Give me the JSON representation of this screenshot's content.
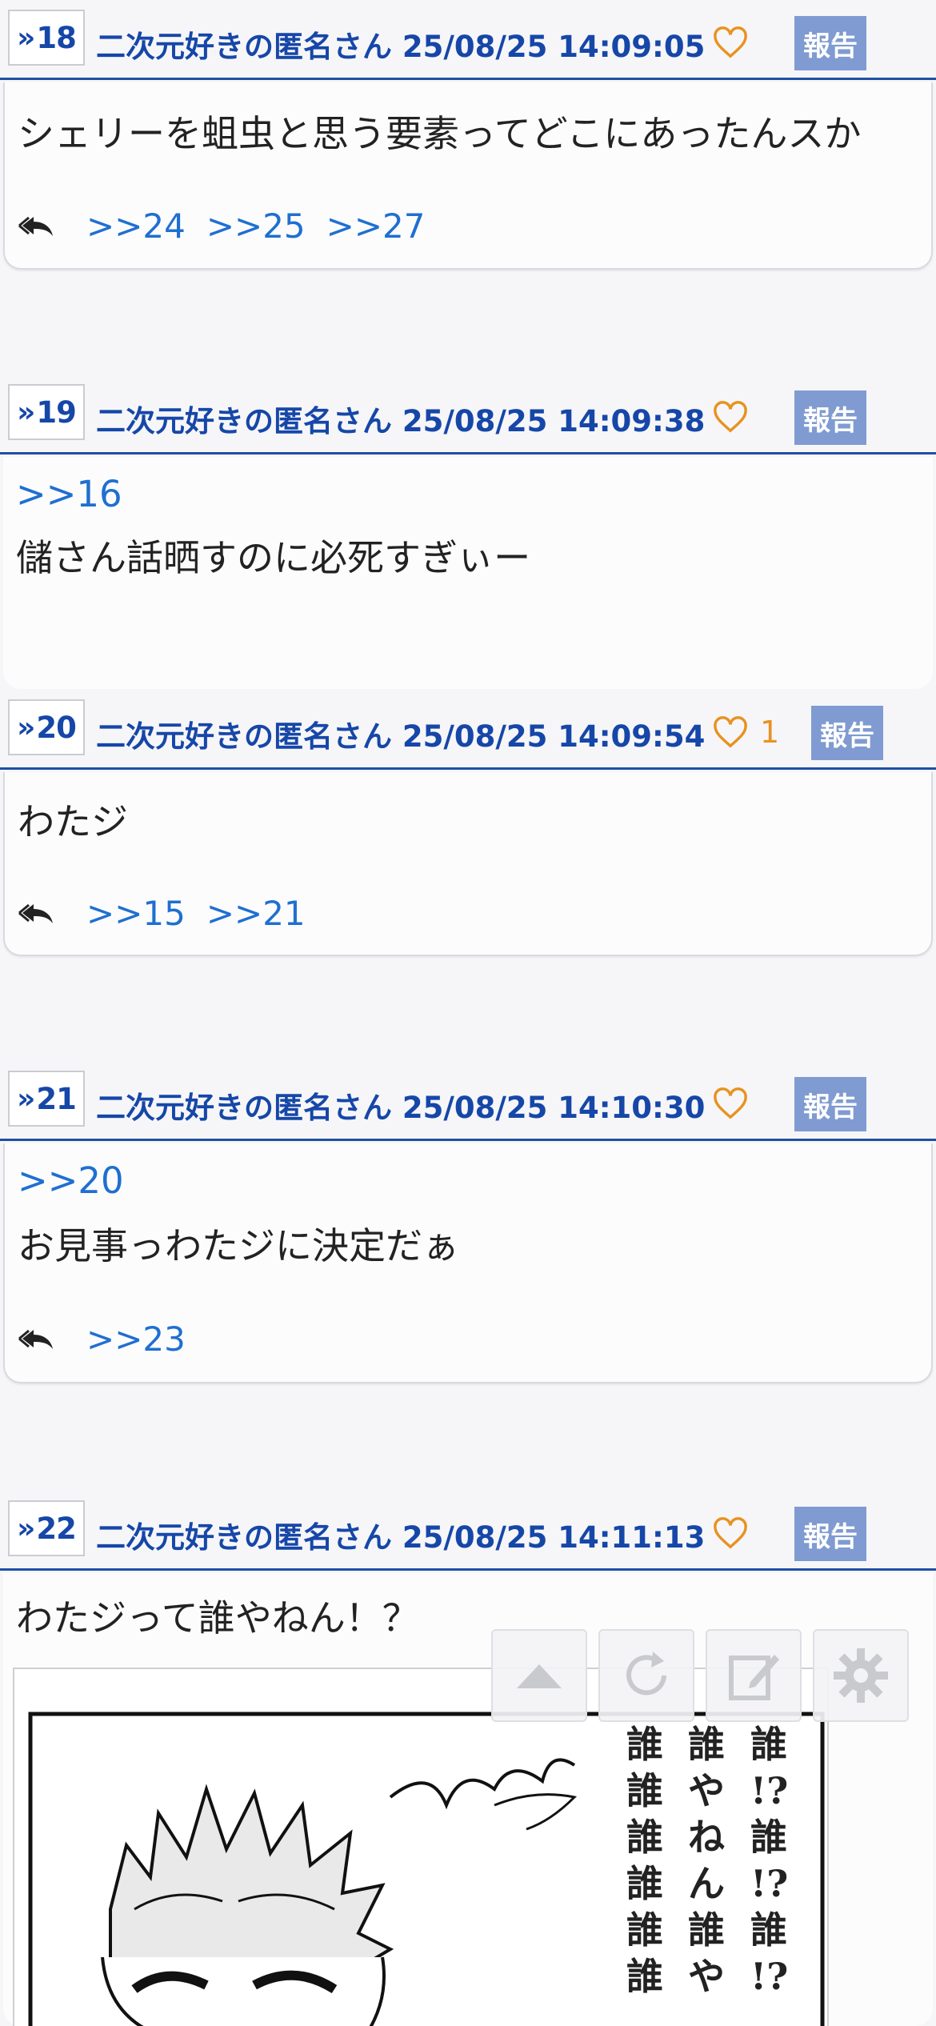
{
  "posts": [
    {
      "number": "18",
      "author": "二次元好きの匿名さん",
      "datetime": "25/08/25 14:09:05",
      "likes": "",
      "report_label": "報告",
      "anchor": "",
      "text": "シェリーを蛆虫と思う要素ってどこにあったんスか",
      "replies": [
        ">>24",
        ">>25",
        ">>27"
      ]
    },
    {
      "number": "19",
      "author": "二次元好きの匿名さん",
      "datetime": "25/08/25 14:09:38",
      "likes": "",
      "report_label": "報告",
      "anchor": ">>16",
      "text": "儲さん話晒すのに必死すぎぃー",
      "replies": []
    },
    {
      "number": "20",
      "author": "二次元好きの匿名さん",
      "datetime": "25/08/25 14:09:54",
      "likes": "1",
      "report_label": "報告",
      "anchor": "",
      "text": "わたジ",
      "replies": [
        ">>15",
        ">>21"
      ]
    },
    {
      "number": "21",
      "author": "二次元好きの匿名さん",
      "datetime": "25/08/25 14:10:30",
      "likes": "",
      "report_label": "報告",
      "anchor": ">>20",
      "text": "お見事っわたジに決定だぁ",
      "replies": [
        ">>23"
      ]
    },
    {
      "number": "22",
      "author": "二次元好きの匿名さん",
      "datetime": "25/08/25 14:11:13",
      "likes": "",
      "report_label": "報告",
      "anchor": "",
      "text": "わたジって誰やねん！？",
      "replies": []
    }
  ],
  "manga_lettering": [
    "誰!?誰!?誰!?",
    "誰やねん誰やね",
    "誰誰誰誰誰誰誰"
  ],
  "floating_buttons": [
    "scroll-top-icon",
    "reload-icon",
    "compose-icon",
    "settings-icon"
  ],
  "colors": {
    "link": "#1f6fd0",
    "header_text": "#1647a8",
    "like": "#e89220",
    "report_bg": "#7f9bd1"
  }
}
